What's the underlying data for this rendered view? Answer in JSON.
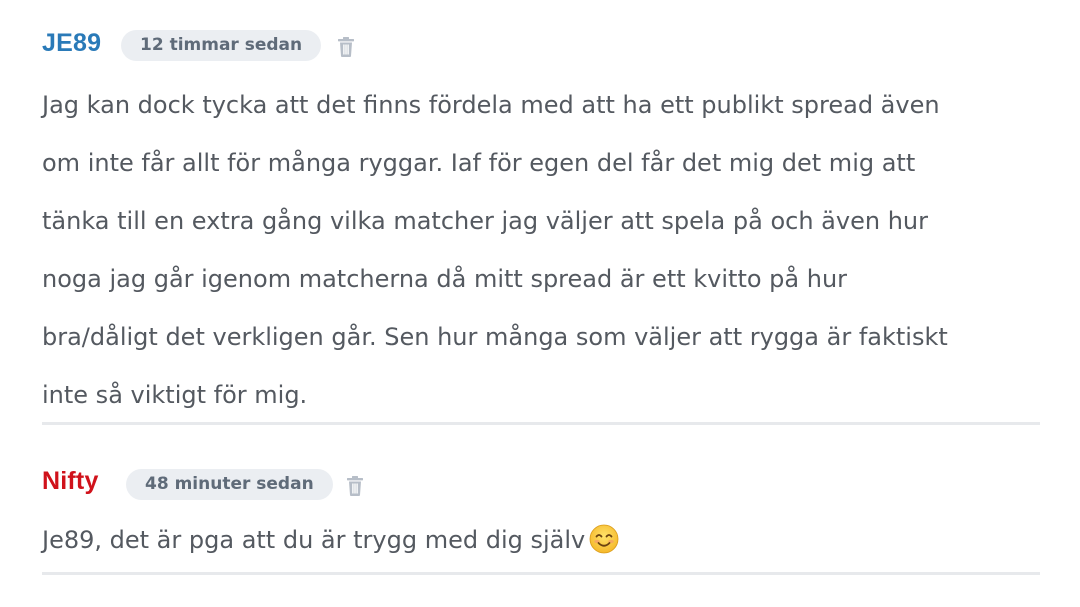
{
  "comments": [
    {
      "username": "JE89",
      "username_color": "#2a7ab8",
      "time": "12 timmar sedan",
      "icon": "trash-icon",
      "lines": [
        "Jag kan dock tycka att det finns fördela med att ha ett publikt spread även",
        "om inte får allt för många ryggar. Iaf för egen del får det mig det mig att",
        "tänka till en extra gång vilka matcher jag väljer att spela på och även hur",
        "noga jag går igenom matcherna då mitt spread är ett kvitto på hur",
        "bra/dåligt det verkligen går. Sen hur många som väljer att rygga är faktiskt",
        "inte så viktigt för mig."
      ]
    },
    {
      "username": "Nifty",
      "username_color": "#d0121b",
      "time": "48 minuter sedan",
      "icon": "trash-icon",
      "text": "Je89, det är pga att du är trygg med dig själv",
      "emoji": "smiling-face-emoji"
    }
  ]
}
